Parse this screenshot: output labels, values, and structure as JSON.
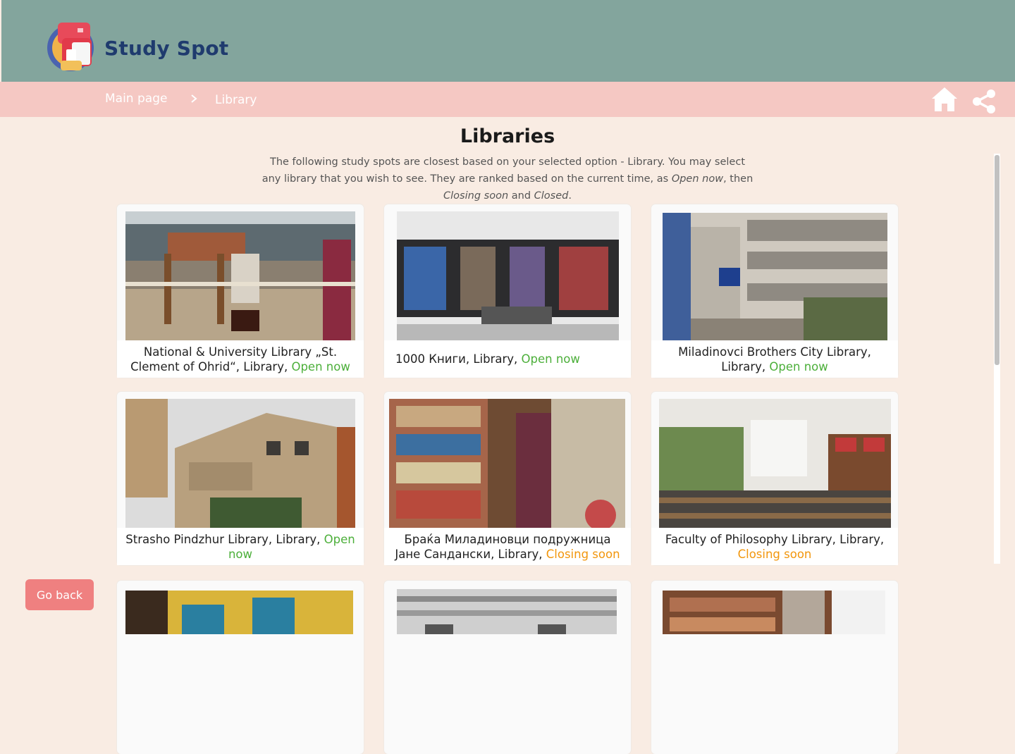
{
  "brand": {
    "name": "Study Spot",
    "logo_icon": "backpack-logo-icon"
  },
  "breadcrumb": {
    "home": "Main page",
    "current": "Library"
  },
  "toolbar": {
    "home_icon": "home-icon",
    "share_icon": "share-icon"
  },
  "page": {
    "title": "Libraries",
    "description_1": "The following study spots are closest based on your selected option - Library. You may select any library that you wish to see. They are ranked based on the current time, as ",
    "status_open_label": "Open now",
    "description_2": ", then ",
    "status_closing_label": "Closing soon",
    "description_3": " and ",
    "status_closed_label": "Closed",
    "description_4": "."
  },
  "cards": [
    {
      "name": "National & University Library „St. Clement of Ohrid“, Library, ",
      "status": "Open now",
      "status_type": "open"
    },
    {
      "name": "1000 Книги, Library, ",
      "status": "Open now",
      "status_type": "open"
    },
    {
      "name": "Miladinovci Brothers City Library, Library, ",
      "status": "Open now",
      "status_type": "open"
    },
    {
      "name": "Strasho Pindzhur Library, Library, ",
      "status": "Open now",
      "status_type": "open"
    },
    {
      "name": "Браќа Миладиновци подружница Јане Сандански, Library, ",
      "status": "Closing soon",
      "status_type": "closing"
    },
    {
      "name": "Faculty of Philosophy Library, Library, ",
      "status": "Closing soon",
      "status_type": "closing"
    }
  ],
  "footer": {
    "back_label": "Go back"
  },
  "colors": {
    "header": "#83a59d",
    "crumb_bar": "#f5c8c3",
    "background": "#f9ece3",
    "open": "#4caf3a",
    "closing": "#f2960c",
    "back_button": "#ef8080"
  }
}
